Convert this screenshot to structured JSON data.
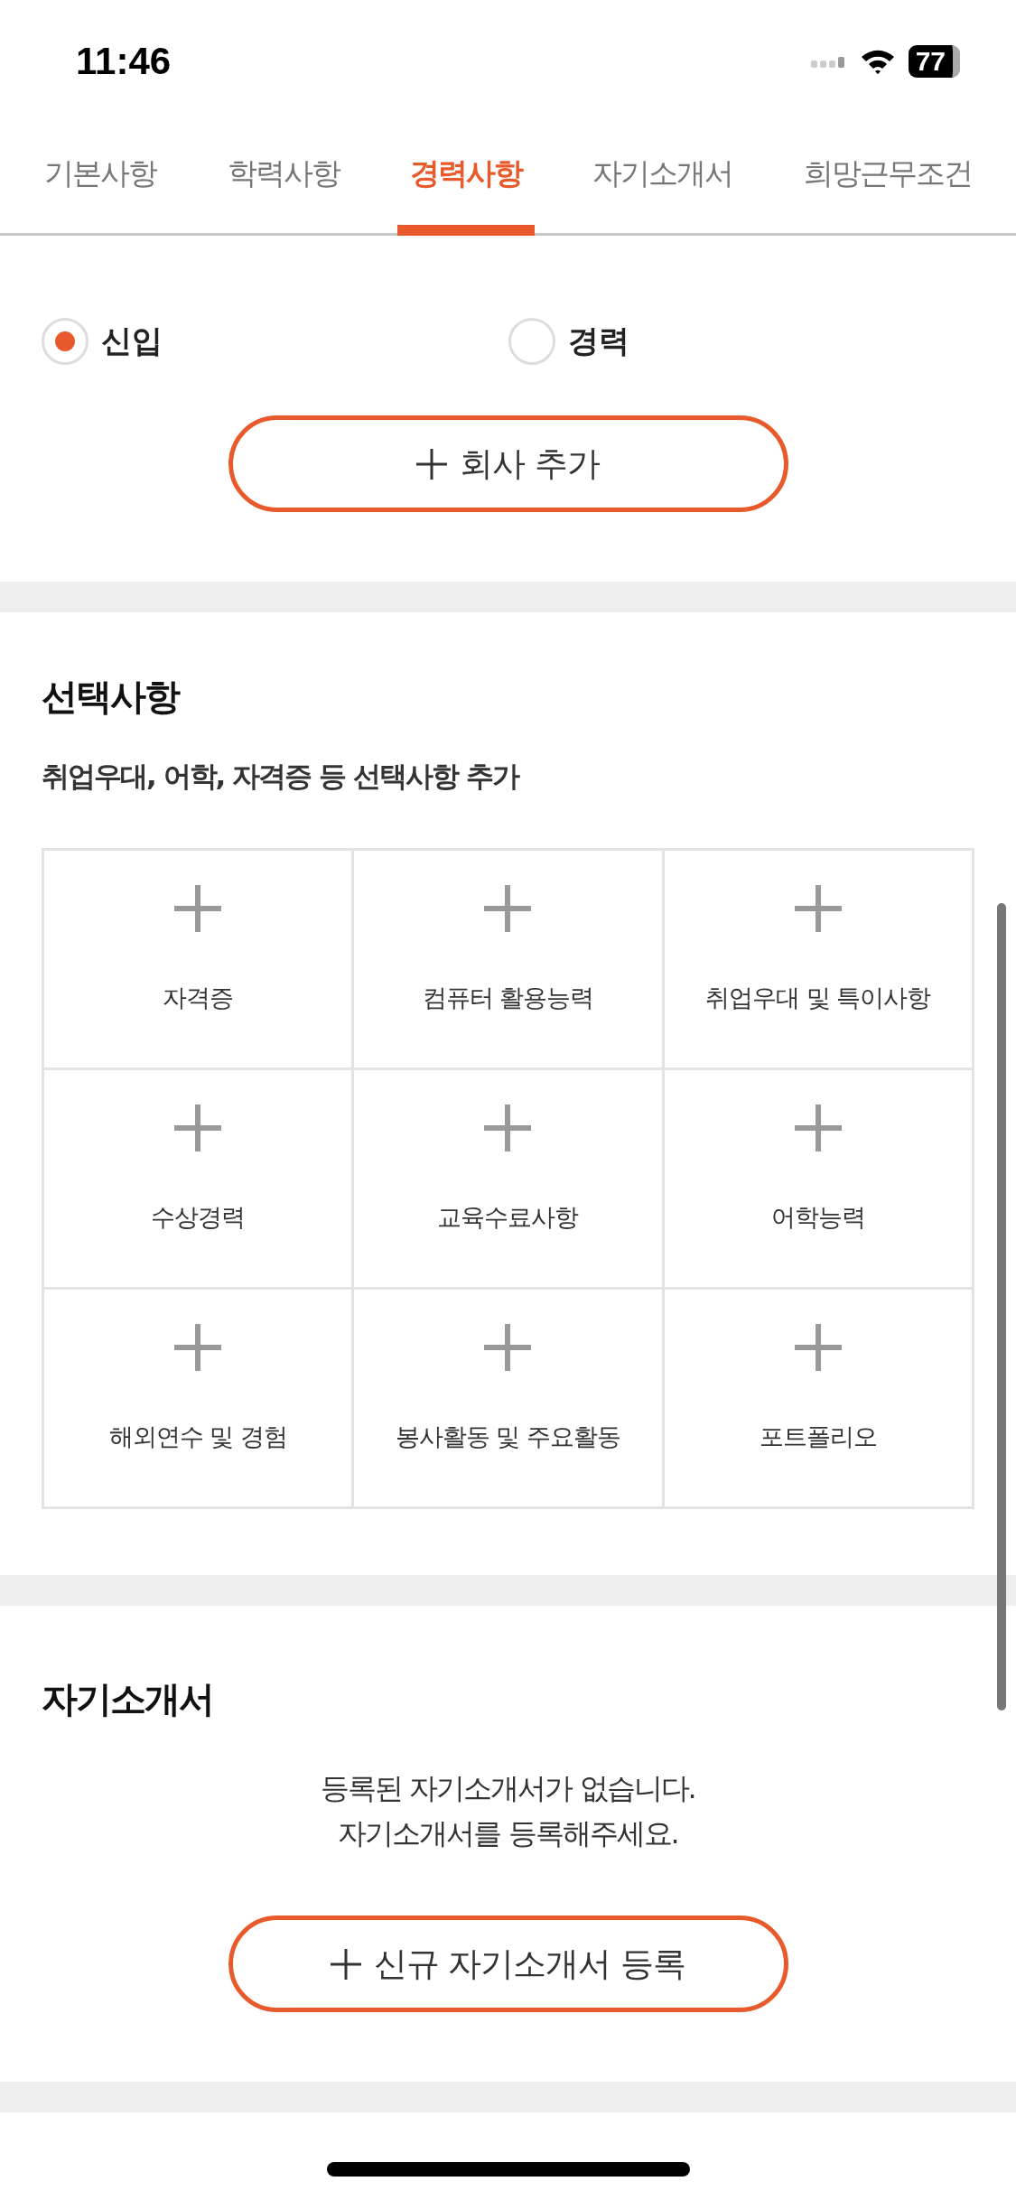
{
  "status_bar": {
    "time": "11:46",
    "battery": "77"
  },
  "tabs": [
    {
      "label": "기본사항",
      "selected": false
    },
    {
      "label": "학력사항",
      "selected": false
    },
    {
      "label": "경력사항",
      "selected": true
    },
    {
      "label": "자기소개서",
      "selected": false
    },
    {
      "label": "희망근무조건",
      "selected": false
    }
  ],
  "career": {
    "options": [
      {
        "label": "신입",
        "selected": true
      },
      {
        "label": "경력",
        "selected": false
      }
    ],
    "add_button": "회사 추가"
  },
  "optional": {
    "title": "선택사항",
    "subtitle": "취업우대, 어학, 자격증 등 선택사항 추가",
    "items": [
      "자격증",
      "컴퓨터 활용능력",
      "취업우대 및 특이사항",
      "수상경력",
      "교육수료사항",
      "어학능력",
      "해외연수 및 경험",
      "봉사활동 및 주요활동",
      "포트폴리오"
    ]
  },
  "intro": {
    "title": "자기소개서",
    "empty_lines": [
      "등록된 자기소개서가 없습니다.",
      "자기소개서를 등록해주세요."
    ],
    "add_button": "신규 자기소개서 등록"
  }
}
